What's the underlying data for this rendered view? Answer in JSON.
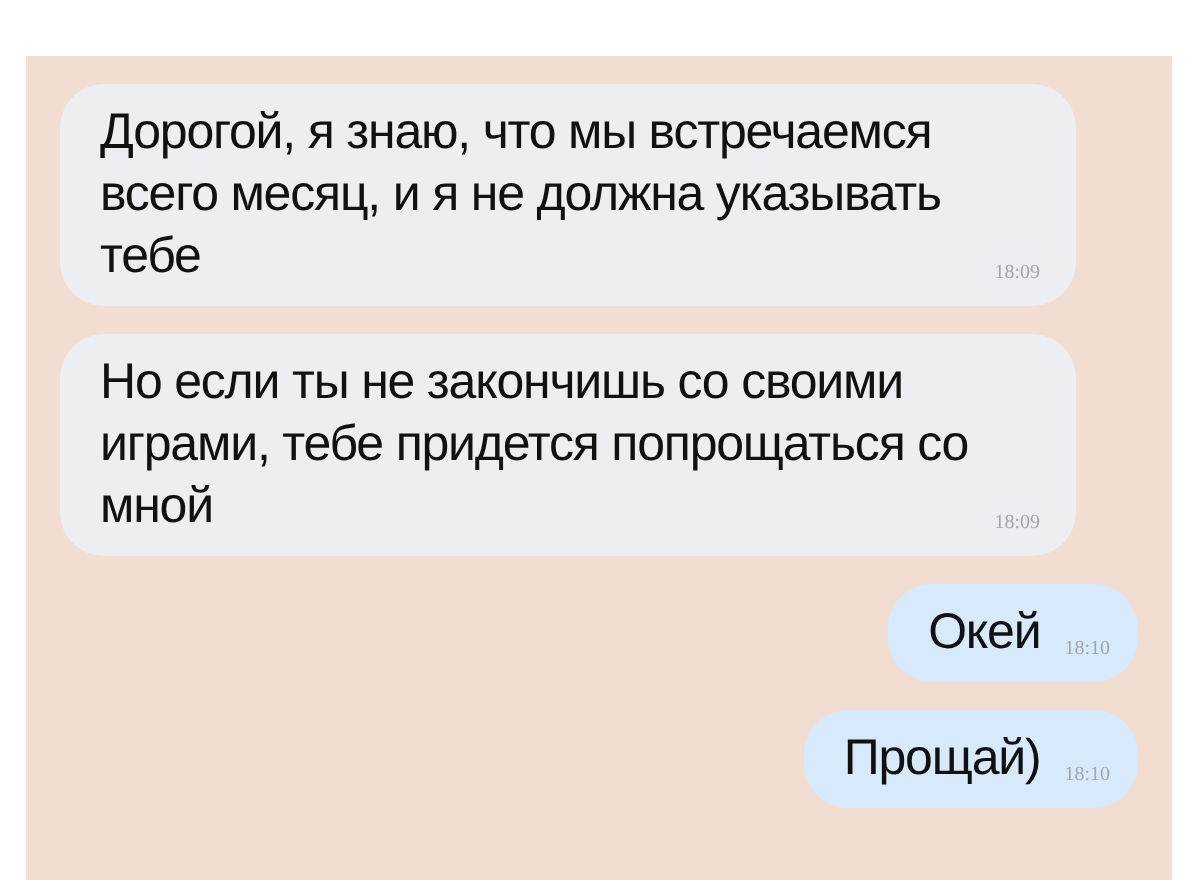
{
  "messages": [
    {
      "kind": "incoming",
      "text": "Дорогой, я знаю, что мы встречаемся всего месяц, и я не должна указывать тебе",
      "time": "18:09"
    },
    {
      "kind": "incoming",
      "text": "Но если ты не закончишь со своими играми, тебе придется попрощаться со мной",
      "time": "18:09"
    },
    {
      "kind": "outgoing",
      "text": "Окей",
      "time": "18:10"
    },
    {
      "kind": "outgoing",
      "text": "Прощай)",
      "time": "18:10"
    }
  ]
}
